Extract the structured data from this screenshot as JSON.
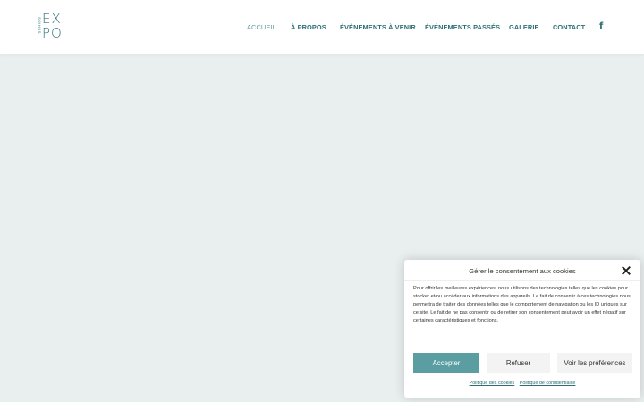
{
  "logo": {
    "side_text": "SCHIOS",
    "line1": "EX",
    "line2": "PO"
  },
  "nav": {
    "items": [
      {
        "label": "ACCUEIL",
        "active": true
      },
      {
        "label": "À PROPOS"
      },
      {
        "label": "ÉVÉNEMENTS À VENIR"
      },
      {
        "label": "ÉVÉNEMENTS PASSÉS"
      },
      {
        "label": "GALERIE"
      },
      {
        "label": "CONTACT"
      }
    ],
    "social_icon": "facebook-icon",
    "social_glyph": "f"
  },
  "cookie_modal": {
    "title": "Gérer le consentement aux cookies",
    "body": "Pour offrir les meilleures expériences, nous utilisons des technologies telles que les cookies pour stocker et/ou accéder aux informations des appareils. Le fait de consentir à ces technologies nous permettra de traiter des données telles que le comportement de navigation ou les ID uniques sur ce site. Le fait de ne pas consentir ou de retirer son consentement peut avoir un effet négatif sur certaines caractéristiques et fonctions.",
    "accept": "Accepter",
    "refuse": "Refuser",
    "preferences": "Voir les préférences",
    "cookie_policy": "Politique des cookies",
    "privacy_policy": "Politique de confidentialité"
  },
  "colors": {
    "accent": "#2b6f74",
    "accept_button": "#5a9ea2",
    "page_background": "#e9eeee"
  }
}
